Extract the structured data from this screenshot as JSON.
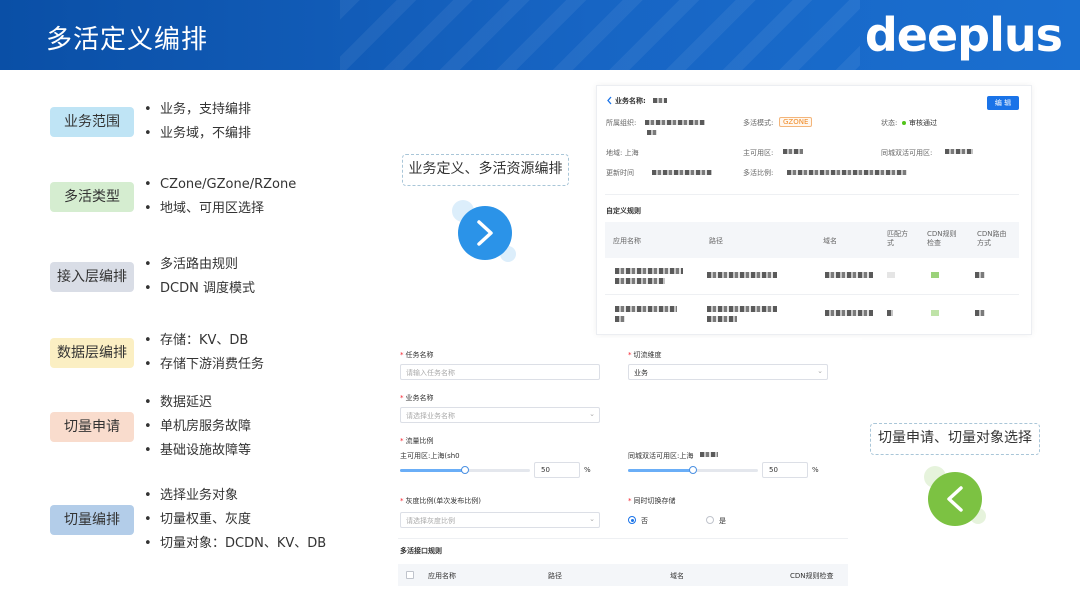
{
  "header": {
    "title": "多活定义编排",
    "logo": "deeplus",
    "colors": {
      "banner": "#1765c4"
    }
  },
  "categories": [
    {
      "label": "业务范围",
      "color": "#bfe4f5",
      "items": [
        "业务，支持编排",
        "业务域，不编排"
      ]
    },
    {
      "label": "多活类型",
      "color": "#d5edd0",
      "items": [
        "CZone/GZone/RZone",
        "地域、可用区选择"
      ]
    },
    {
      "label": "接入层编排",
      "color": "#d9dde6",
      "items": [
        "多活路由规则",
        "DCDN 调度模式"
      ]
    },
    {
      "label": "数据层编排",
      "color": "#fbefc3",
      "items": [
        "存储：KV、DB",
        "存储下游消费任务"
      ]
    },
    {
      "label": "切量申请",
      "color": "#f9dccd",
      "items": [
        "数据延迟",
        "单机房服务故障",
        "基础设施故障等"
      ]
    },
    {
      "label": "切量编排",
      "color": "#b3cde9",
      "items": [
        "选择业务对象",
        "切量权重、灰度",
        "切量对象：DCDN、KV、DB"
      ]
    }
  ],
  "callouts": {
    "top": "业务定义、多活资源编排",
    "bottom": "切量申请、切量对象选择",
    "next_icon": "chevron-right-icon",
    "prev_icon": "chevron-left-icon",
    "next_color": "#2b93e8",
    "prev_color": "#7cc242"
  },
  "detail": {
    "back_icon": "chevron-left-icon",
    "title": "业务名称:",
    "edit_label": "编 辑",
    "org_label": "所属组织:",
    "mode_label": "多活模式:",
    "mode_value": "GZONE",
    "status_label": "状态:",
    "status_value": "审核通过",
    "region_label": "地域: 上海",
    "primary_label": "主可用区:",
    "dual_label": "同城双活可用区:",
    "updated_label": "更新时间",
    "ratio_label": "多活比例:",
    "rules_title": "自定义规则",
    "columns": [
      "应用名称",
      "路径",
      "域名",
      "匹配方式",
      "CDN规则检查",
      "CDN路由方式"
    ]
  },
  "form": {
    "task_name_label": "任务名称",
    "task_name_placeholder": "请输入任务名称",
    "cut_dim_label": "切流维度",
    "cut_dim_value": "业务",
    "biz_name_label": "业务名称",
    "biz_name_placeholder": "请选择业务名称",
    "traffic_label": "流量比例",
    "primary_zone_label": "主可用区:上海(sh0",
    "dual_zone_label": "同城双活可用区:上海",
    "primary_value": "50",
    "dual_value": "50",
    "pct": "%",
    "gray_label": "灰度比例(单次发布比例)",
    "gray_placeholder": "请选择灰度比例",
    "sync_label": "同时切换存储",
    "no_label": "否",
    "yes_label": "是",
    "rules_title": "多活接口规则",
    "columns": [
      "应用名称",
      "路径",
      "域名",
      "CDN规则检查"
    ],
    "slider_primary": 0.5,
    "slider_dual": 0.5
  }
}
